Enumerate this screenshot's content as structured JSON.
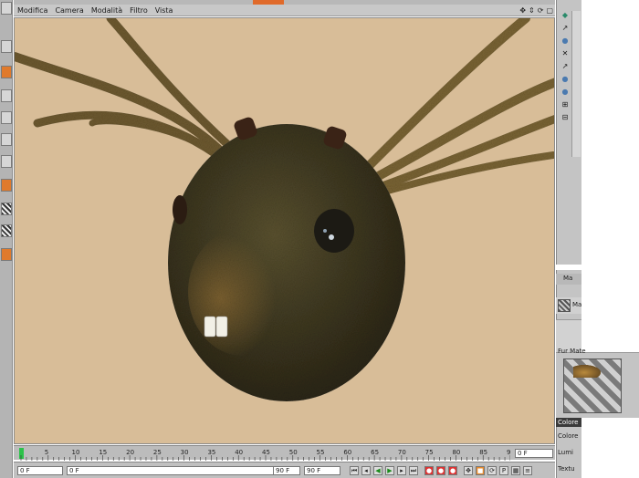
{
  "menu": {
    "items": [
      "Modifica",
      "Camera",
      "Modalità",
      "Filtro",
      "Vista"
    ]
  },
  "view_nav": {
    "icons": [
      "move-icon",
      "zoom-icon",
      "rotate-icon",
      "maximize-icon"
    ],
    "glyphs": [
      "✥",
      "⇕",
      "⟳",
      "▢"
    ]
  },
  "material": {
    "header_fragment": "Ma",
    "name_fragment": "Ma",
    "label_fragment": "Fur Mate",
    "channel_label": "Colore",
    "options": [
      "Colore",
      "Lumi",
      "Textu"
    ]
  },
  "timeline": {
    "ticks": [
      "0",
      "5",
      "10",
      "15",
      "20",
      "25",
      "30",
      "35",
      "40",
      "45",
      "50",
      "55",
      "60",
      "65",
      "70",
      "75",
      "80",
      "85",
      "90"
    ],
    "current_frame": "0 F"
  },
  "transport": {
    "start_field": "0 F",
    "preview_start": "0 F",
    "preview_end": "90 F",
    "end_field": "90 F"
  },
  "colors": {
    "background_scene": "#d8bd98",
    "fur_base": "#4b4226",
    "accent_orange": "#e06a2a"
  }
}
